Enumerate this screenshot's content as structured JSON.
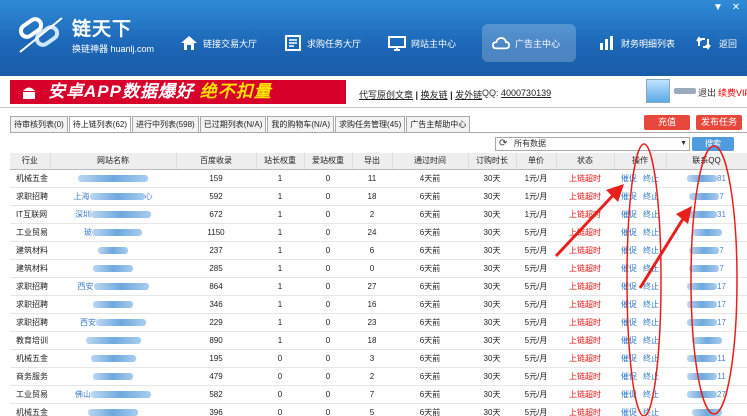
{
  "app": {
    "logo_title": "链天下",
    "logo_subtitle": "换链神器 huanlj.com",
    "window_controls": [
      "▼",
      "✕"
    ]
  },
  "nav": [
    {
      "label": "链接交易大厅",
      "icon": "home-icon"
    },
    {
      "label": "求购任务大厅",
      "icon": "document-icon"
    },
    {
      "label": "网站主中心",
      "icon": "monitor-icon"
    },
    {
      "label": "广告主中心",
      "icon": "cloud-icon",
      "active": true
    },
    {
      "label": "财务明细列表",
      "icon": "bar-chart-icon"
    },
    {
      "label": "返回",
      "icon": "return-arrows-icon"
    }
  ],
  "banner": {
    "ad_text": "安卓APP数据爆好",
    "ad_highlight": "绝不扣量",
    "link_1": "代写原创文章",
    "link_2": "换友链",
    "link_3": "发外链",
    "sep": "|",
    "qq_label": "QQ:",
    "qq_value": "4000730139"
  },
  "user": {
    "logout": "退出",
    "vip": "续费VIP"
  },
  "tabs": [
    {
      "label": "待审核列表(0)"
    },
    {
      "label": "待上链列表(62)",
      "active": true
    },
    {
      "label": "进行中列表(598)"
    },
    {
      "label": "已过期列表(N/A)"
    },
    {
      "label": "我的购物车(N/A)"
    },
    {
      "label": "求购任务管理(45)"
    },
    {
      "label": "广告主帮助中心"
    }
  ],
  "buttons": {
    "recharge": "充值",
    "publish": "发布任务",
    "search": "搜索"
  },
  "filter": {
    "value": "所有数据",
    "refresh_icon": "⟳",
    "arrow": "▼"
  },
  "table": {
    "headers": [
      "行业",
      "网站名称",
      "百度收录",
      "站长权重",
      "爱站权重",
      "导出",
      "通过时间",
      "订购时长",
      "单价",
      "状态",
      "操作",
      "联系QQ"
    ],
    "op_urge": "催促",
    "op_stop": "终止",
    "rows": [
      {
        "industry": "机械五金",
        "site_prefix": "",
        "site_suffix": "",
        "baidu": "159",
        "zz": "1",
        "az": "0",
        "export": "11",
        "pass": "4天前",
        "dur": "30天",
        "price": "1元/月",
        "status": "上链超时",
        "qq_tail": "81"
      },
      {
        "industry": "求职招聘",
        "site_prefix": "上海",
        "site_suffix": "心",
        "baidu": "592",
        "zz": "1",
        "az": "0",
        "export": "18",
        "pass": "6天前",
        "dur": "30天",
        "price": "1元/月",
        "status": "上链超时",
        "qq_tail": "7"
      },
      {
        "industry": "IT互联网",
        "site_prefix": "深圳",
        "site_suffix": "",
        "baidu": "672",
        "zz": "1",
        "az": "0",
        "export": "2",
        "pass": "6天前",
        "dur": "30天",
        "price": "1元/月",
        "status": "上链超时",
        "qq_tail": "31"
      },
      {
        "industry": "工业贸易",
        "site_prefix": "玻",
        "site_suffix": "",
        "baidu": "1150",
        "zz": "1",
        "az": "0",
        "export": "24",
        "pass": "6天前",
        "dur": "30天",
        "price": "5元/月",
        "status": "上链超时",
        "qq_tail": ""
      },
      {
        "industry": "建筑材料",
        "site_prefix": "",
        "site_suffix": "",
        "baidu": "237",
        "zz": "1",
        "az": "0",
        "export": "6",
        "pass": "6天前",
        "dur": "30天",
        "price": "5元/月",
        "status": "上链超时",
        "qq_tail": "7"
      },
      {
        "industry": "建筑材料",
        "site_prefix": "",
        "site_suffix": "",
        "baidu": "285",
        "zz": "1",
        "az": "0",
        "export": "0",
        "pass": "6天前",
        "dur": "30天",
        "price": "5元/月",
        "status": "上链超时",
        "qq_tail": "7"
      },
      {
        "industry": "求职招聘",
        "site_prefix": "西安",
        "site_suffix": "",
        "baidu": "864",
        "zz": "1",
        "az": "0",
        "export": "27",
        "pass": "6天前",
        "dur": "30天",
        "price": "5元/月",
        "status": "上链超时",
        "qq_tail": "17"
      },
      {
        "industry": "求职招聘",
        "site_prefix": "",
        "site_suffix": "",
        "baidu": "346",
        "zz": "1",
        "az": "0",
        "export": "16",
        "pass": "6天前",
        "dur": "30天",
        "price": "5元/月",
        "status": "上链超时",
        "qq_tail": "17"
      },
      {
        "industry": "求职招聘",
        "site_prefix": "西安",
        "site_suffix": "",
        "baidu": "229",
        "zz": "1",
        "az": "0",
        "export": "23",
        "pass": "6天前",
        "dur": "30天",
        "price": "5元/月",
        "status": "上链超时",
        "qq_tail": "17"
      },
      {
        "industry": "教育培训",
        "site_prefix": "",
        "site_suffix": "",
        "baidu": "890",
        "zz": "1",
        "az": "0",
        "export": "18",
        "pass": "6天前",
        "dur": "30天",
        "price": "5元/月",
        "status": "上链超时",
        "qq_tail": ""
      },
      {
        "industry": "机械五金",
        "site_prefix": "",
        "site_suffix": "",
        "baidu": "195",
        "zz": "0",
        "az": "0",
        "export": "3",
        "pass": "6天前",
        "dur": "30天",
        "price": "5元/月",
        "status": "上链超时",
        "qq_tail": "11"
      },
      {
        "industry": "商务服务",
        "site_prefix": "",
        "site_suffix": "",
        "baidu": "479",
        "zz": "0",
        "az": "0",
        "export": "2",
        "pass": "6天前",
        "dur": "30天",
        "price": "5元/月",
        "status": "上链超时",
        "qq_tail": "11"
      },
      {
        "industry": "工业贸易",
        "site_prefix": "佛山",
        "site_suffix": "",
        "baidu": "582",
        "zz": "0",
        "az": "0",
        "export": "7",
        "pass": "6天前",
        "dur": "30天",
        "price": "5元/月",
        "status": "上链超时",
        "qq_tail": "27"
      },
      {
        "industry": "机械五金",
        "site_prefix": "",
        "site_suffix": "",
        "baidu": "396",
        "zz": "0",
        "az": "0",
        "export": "5",
        "pass": "6天前",
        "dur": "30天",
        "price": "5元/月",
        "status": "上链超时",
        "qq_tail": ""
      }
    ]
  },
  "colors": {
    "header_blue": "#1c66b6",
    "ad_red": "#d7002a",
    "status_red": "#e01010",
    "action_blue": "#2a78c8",
    "annotation_red": "#e8201c"
  }
}
